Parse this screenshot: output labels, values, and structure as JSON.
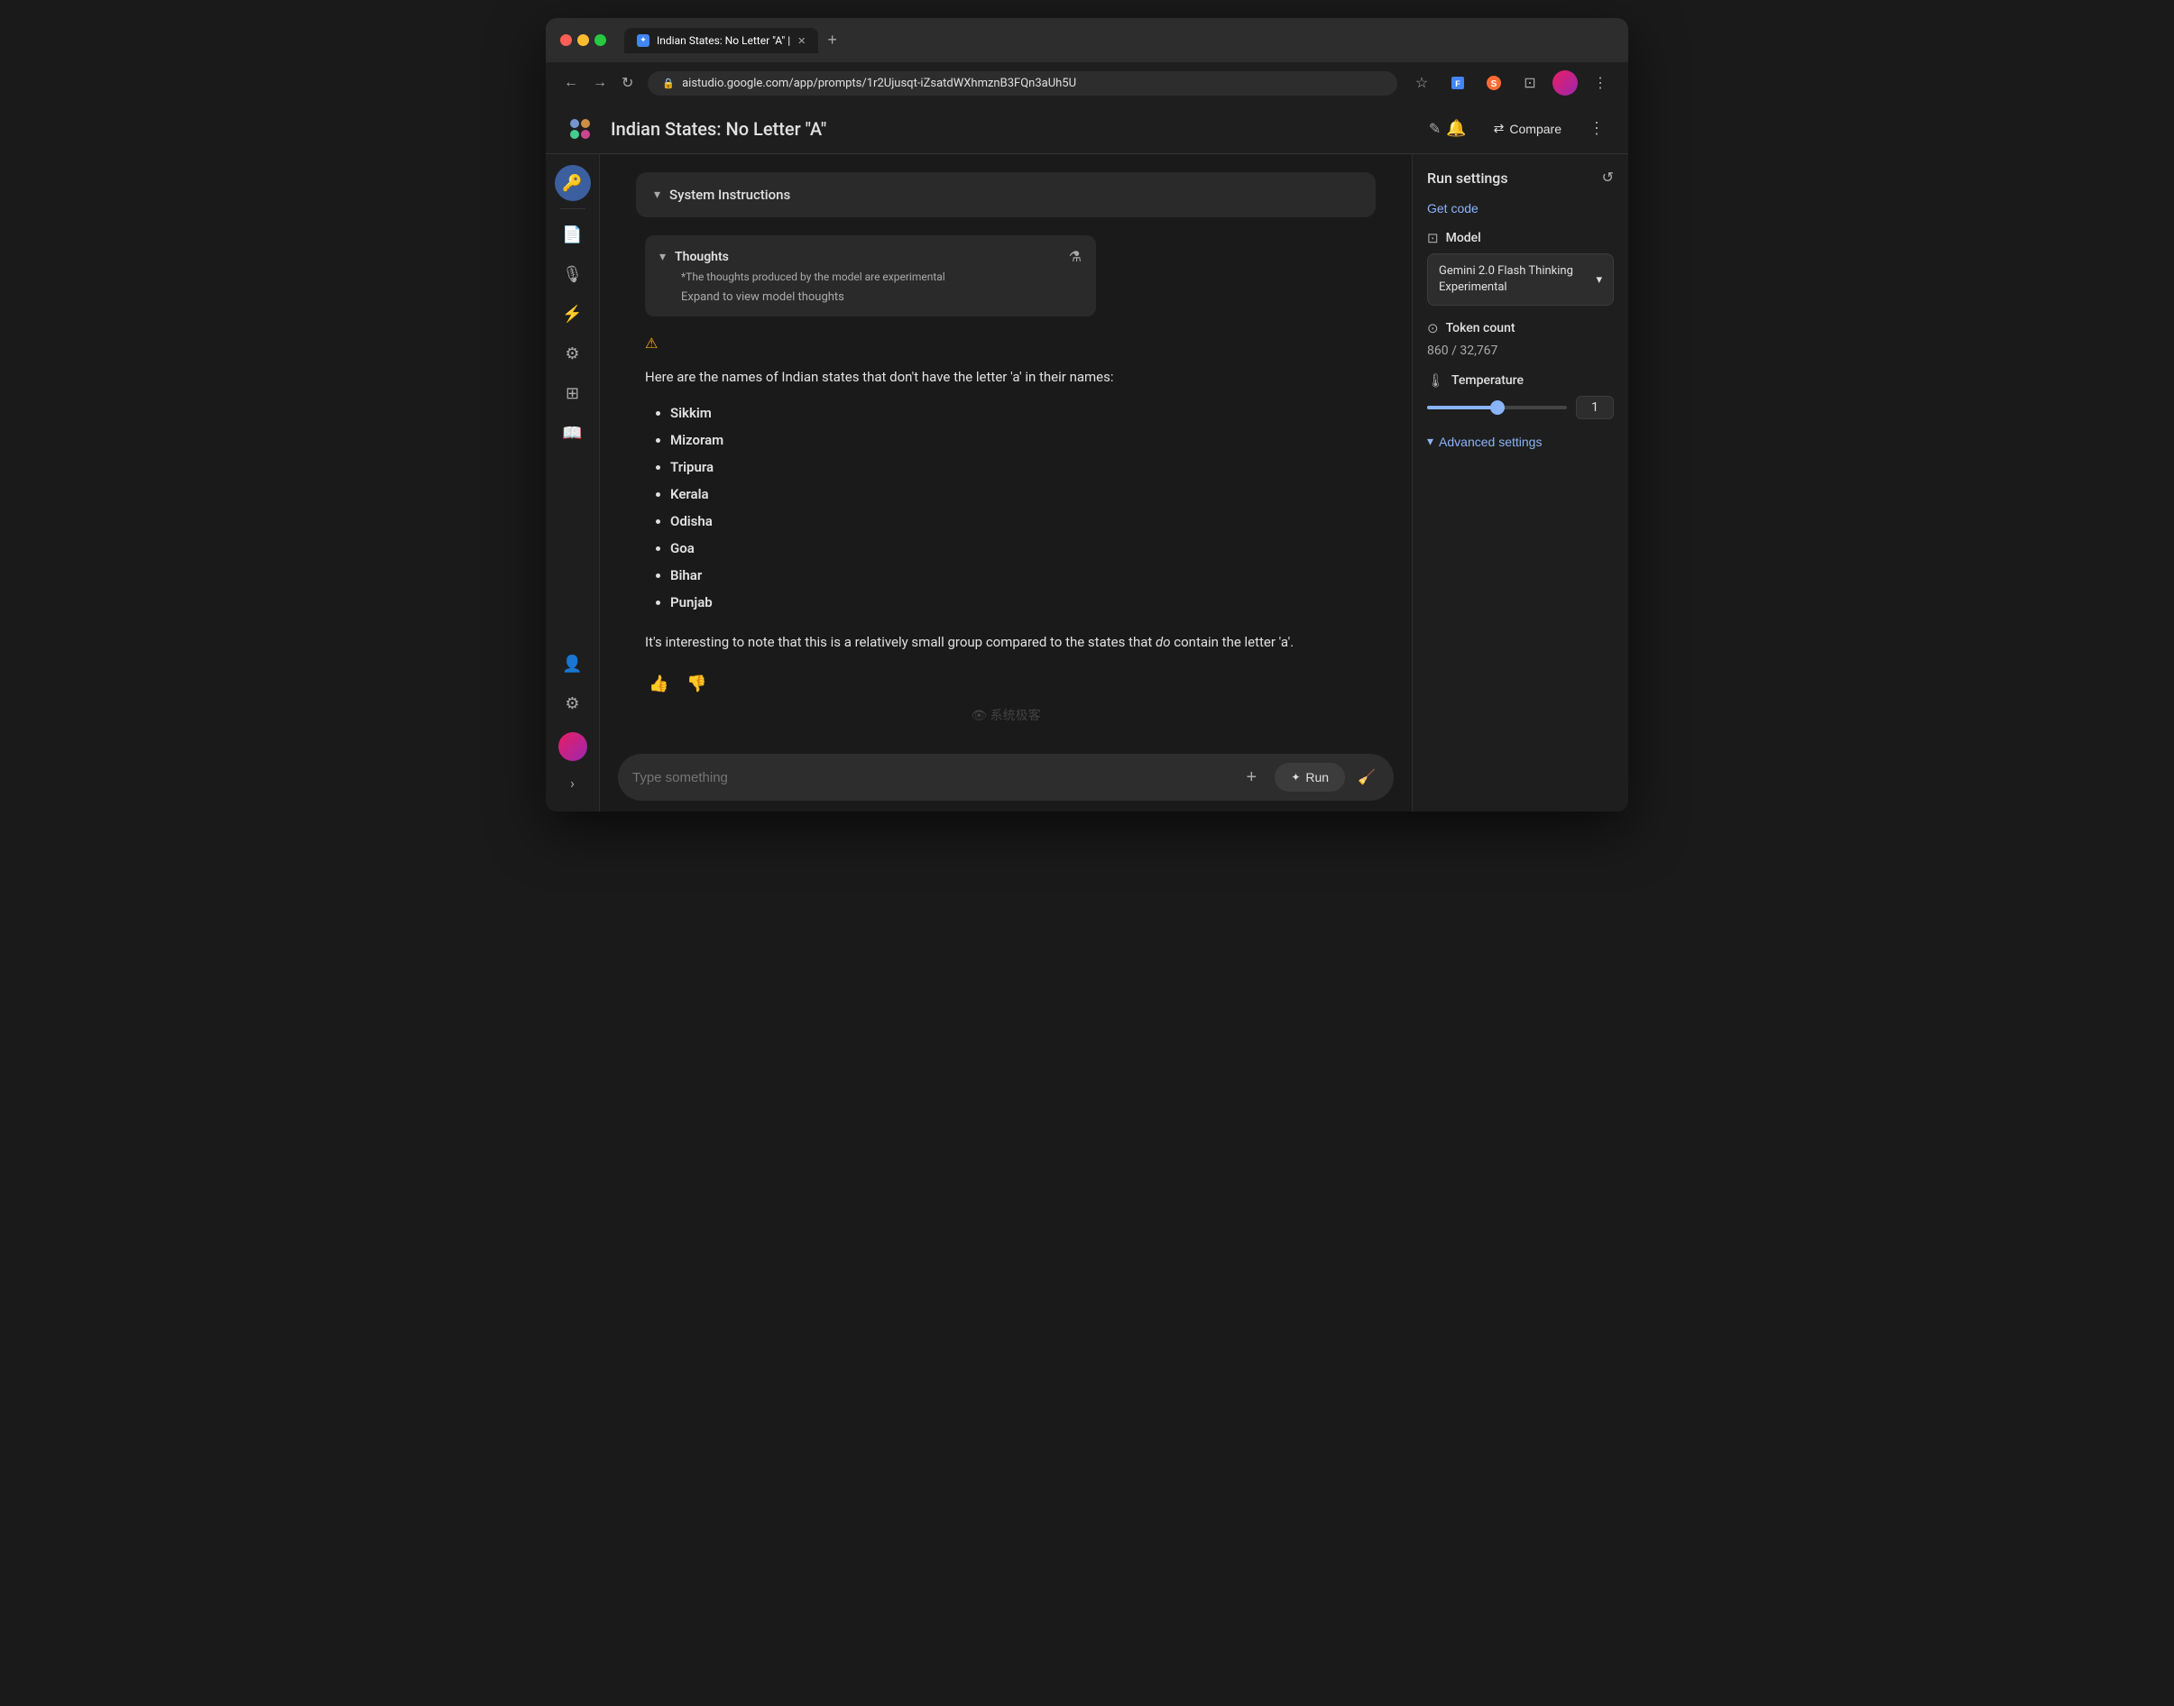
{
  "browser": {
    "tab_label": "Indian States: No Letter \"A\" |",
    "tab_icon": "✦",
    "url": "aistudio.google.com/app/prompts/1r2Ujusqt-iZsatdWXhmznB3FQn3aUh5U",
    "new_tab_label": "+"
  },
  "header": {
    "logo_text": "✦",
    "title": "Indian States: No Letter \"A\"",
    "edit_icon": "✎",
    "compare_label": "Compare",
    "compare_icon": "⇄",
    "more_icon": "⋮",
    "alert_icon": "🔔"
  },
  "sidebar_left": {
    "items": [
      {
        "id": "key",
        "icon": "🔑",
        "active": true
      },
      {
        "id": "document",
        "icon": "📄",
        "active": false
      },
      {
        "id": "mic",
        "icon": "🎙",
        "active": false
      },
      {
        "id": "lightning",
        "icon": "⚡",
        "active": false
      },
      {
        "id": "sliders",
        "icon": "⚙",
        "active": false
      },
      {
        "id": "layers",
        "icon": "⊞",
        "active": false
      },
      {
        "id": "book",
        "icon": "📖",
        "active": false
      }
    ],
    "bottom_items": [
      {
        "id": "person",
        "icon": "👤"
      },
      {
        "id": "code",
        "icon": "{ }"
      },
      {
        "id": "grid",
        "icon": "⊞"
      }
    ],
    "info_icon": "ℹ",
    "settings_icon": "⚙",
    "expand_icon": "›"
  },
  "system_instructions": {
    "label": "System Instructions",
    "collapse_icon": "▾"
  },
  "response": {
    "thoughts": {
      "title": "Thoughts",
      "subtitle": "*The thoughts produced by the model are experimental",
      "expand_label": "Expand to view model thoughts",
      "flask_icon": "⚗"
    },
    "warning_icon": "⚠",
    "intro_text": "Here are the names of Indian states that don't have the letter 'a' in their names:",
    "states": [
      "Sikkim",
      "Mizoram",
      "Tripura",
      "Kerala",
      "Odisha",
      "Goa",
      "Bihar",
      "Punjab"
    ],
    "note_before_em": "It's interesting to note that this is a relatively small group compared to the states that ",
    "note_em": "do",
    "note_after_em": " contain the letter 'a'.",
    "thumbup_icon": "👍",
    "thumbdown_icon": "👎"
  },
  "watermark": "👁 系统极客",
  "input": {
    "placeholder": "Type something",
    "add_icon": "+",
    "run_label": "Run",
    "run_icon": "✦",
    "clean_icon": "🧹"
  },
  "run_settings": {
    "title": "Run settings",
    "refresh_icon": "↺",
    "get_code_label": "Get code",
    "code_icon": "<>",
    "model_section": {
      "label": "Model",
      "icon": "⊡"
    },
    "model_name": "Gemini 2.0 Flash Thinking Experimental",
    "dropdown_icon": "▾",
    "token_count": {
      "label": "Token count",
      "icon": "⊙",
      "value": "860 / 32,767"
    },
    "temperature": {
      "label": "Temperature",
      "icon": "🌡",
      "value": 1,
      "min": 0,
      "max": 2
    },
    "advanced_settings": {
      "label": "Advanced settings",
      "icon": "▾"
    }
  }
}
